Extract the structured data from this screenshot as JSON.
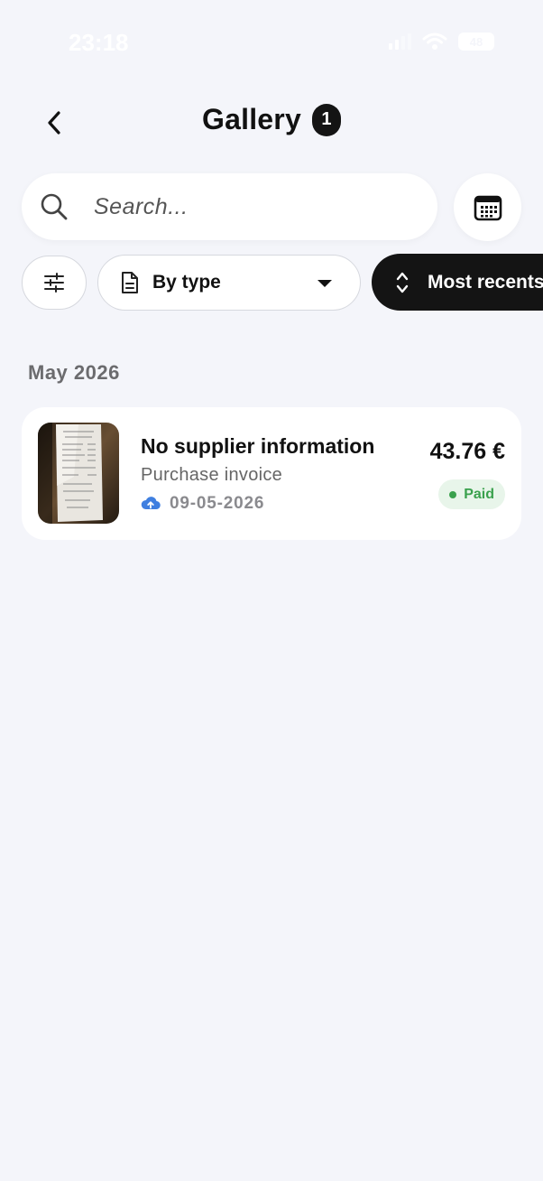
{
  "status_bar": {
    "time": "23:18",
    "battery": "48"
  },
  "header": {
    "title": "Gallery",
    "count": "1"
  },
  "search": {
    "placeholder": "Search..."
  },
  "filters": {
    "type_label": "By type",
    "sort_label": "Most recents"
  },
  "sections": [
    {
      "heading": "May 2026",
      "items": [
        {
          "title": "No supplier information",
          "subtitle": "Purchase invoice",
          "date": "09-05-2026",
          "amount": "43.76 €",
          "status": "Paid"
        }
      ]
    }
  ],
  "colors": {
    "background": "#f4f5fa",
    "accent_dark": "#141414",
    "paid_green": "#3aa14d",
    "paid_bg": "#e8f5ea",
    "cloud_blue": "#3f7fe0"
  },
  "icons": [
    "back-chevron-icon",
    "search-icon",
    "calendar-icon",
    "sliders-icon",
    "document-icon",
    "caret-down-icon",
    "sort-arrows-icon",
    "cloud-upload-icon"
  ]
}
